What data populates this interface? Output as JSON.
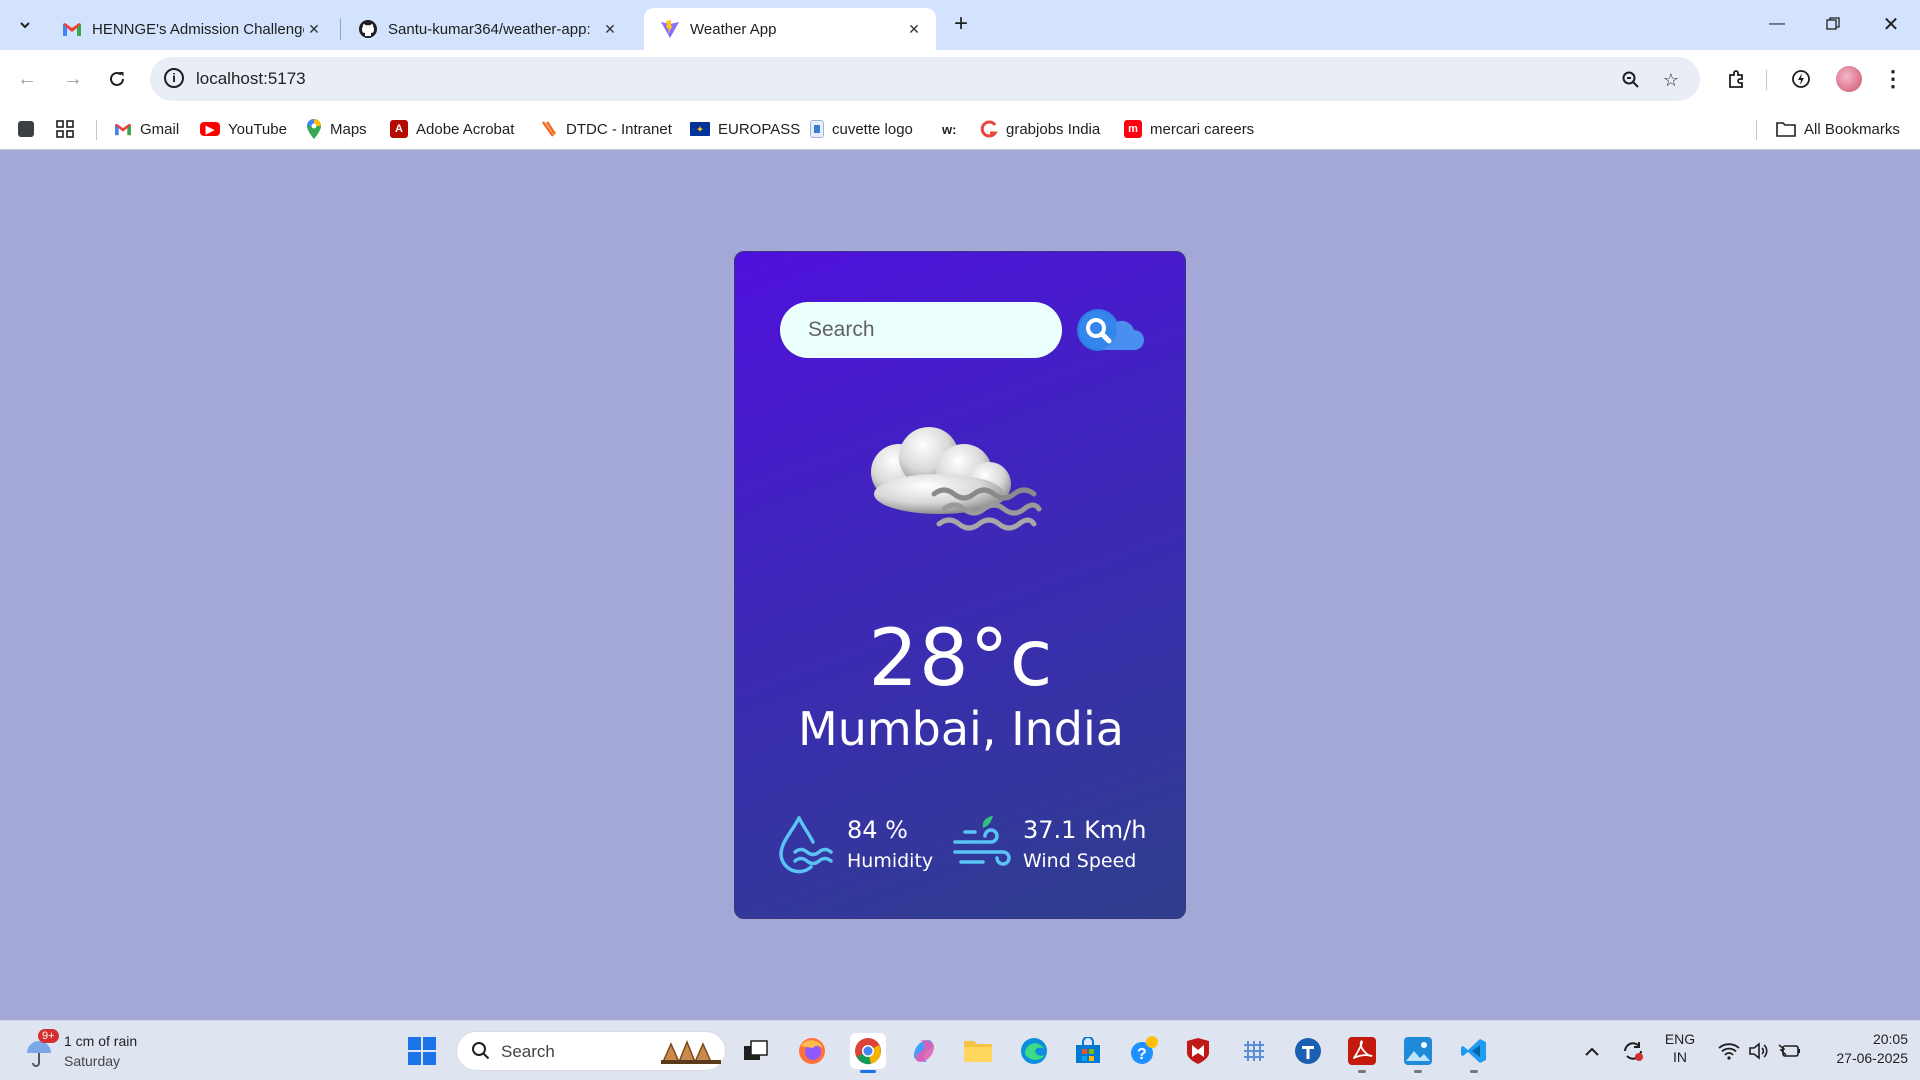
{
  "browser": {
    "tabs": [
      {
        "title": "HENNGE's Admission Challenge",
        "icon": "gmail-icon"
      },
      {
        "title": "Santu-kumar364/weather-app:",
        "icon": "github-icon"
      },
      {
        "title": "Weather App",
        "icon": "vite-icon",
        "active": true
      }
    ],
    "address": "localhost:5173",
    "bookmarks": [
      {
        "label": "Gmail",
        "icon": "gmail-icon",
        "color": "#ea4335"
      },
      {
        "label": "YouTube",
        "icon": "youtube-icon",
        "color": "#ff0000"
      },
      {
        "label": "Maps",
        "icon": "maps-icon",
        "color": "#34a853"
      },
      {
        "label": "Adobe Acrobat",
        "icon": "acrobat-icon",
        "color": "#b30b00"
      },
      {
        "label": "DTDC - Intranet",
        "icon": "dtdc-icon",
        "color": "#f06a23"
      },
      {
        "label": "EUROPASS",
        "icon": "eu-flag-icon",
        "color": "#003399"
      },
      {
        "label": "cuvette logo",
        "icon": "cuvette-icon",
        "color": "#3b7bd6"
      },
      {
        "label": "w:",
        "icon": "",
        "color": ""
      },
      {
        "label": "grabjobs India",
        "icon": "grabjobs-icon",
        "color": "#e8473c"
      },
      {
        "label": "mercari careers",
        "icon": "mercari-icon",
        "color": "#ff0211"
      }
    ],
    "all_bookmarks": "All Bookmarks"
  },
  "weather": {
    "search_placeholder": "Search",
    "temperature": "28°c",
    "city": "Mumbai, India",
    "humidity_value": "84 %",
    "humidity_label": "Humidity",
    "wind_value": "37.1 Km/h",
    "wind_label": "Wind Speed",
    "condition_icon": "mist-cloud-icon"
  },
  "taskbar": {
    "weather_text": "1 cm of rain",
    "weather_day": "Saturday",
    "weather_badge": "9+",
    "search_label": "Search",
    "lang_top": "ENG",
    "lang_bottom": "IN",
    "time": "20:05",
    "date": "27-06-2025"
  }
}
